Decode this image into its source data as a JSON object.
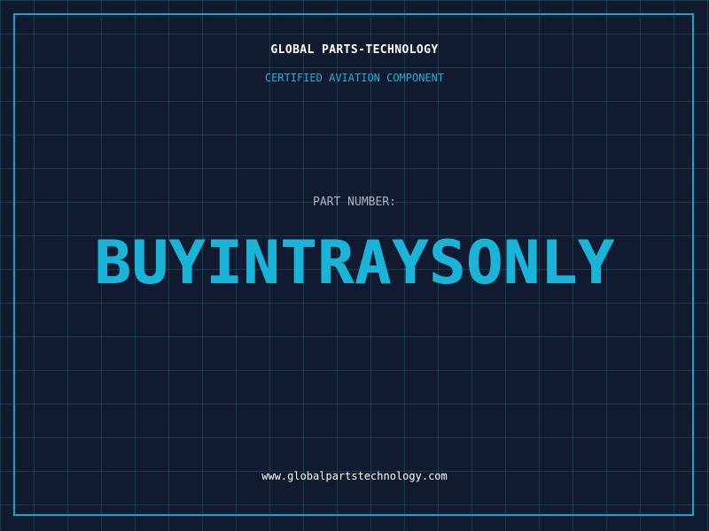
{
  "header": {
    "company_name": "GLOBAL PARTS-TECHNOLOGY",
    "subtitle": "CERTIFIED AVIATION COMPONENT"
  },
  "part": {
    "label": "PART NUMBER:",
    "number": "BUYINTRAYSONLY"
  },
  "footer": {
    "website": "www.globalpartstechnology.com"
  },
  "colors": {
    "background": "#111a2e",
    "grid": "#188096",
    "accent": "#1bb4d9",
    "frame": "#19a3c8",
    "text": "#ffffff",
    "label": "#aab3c0"
  }
}
